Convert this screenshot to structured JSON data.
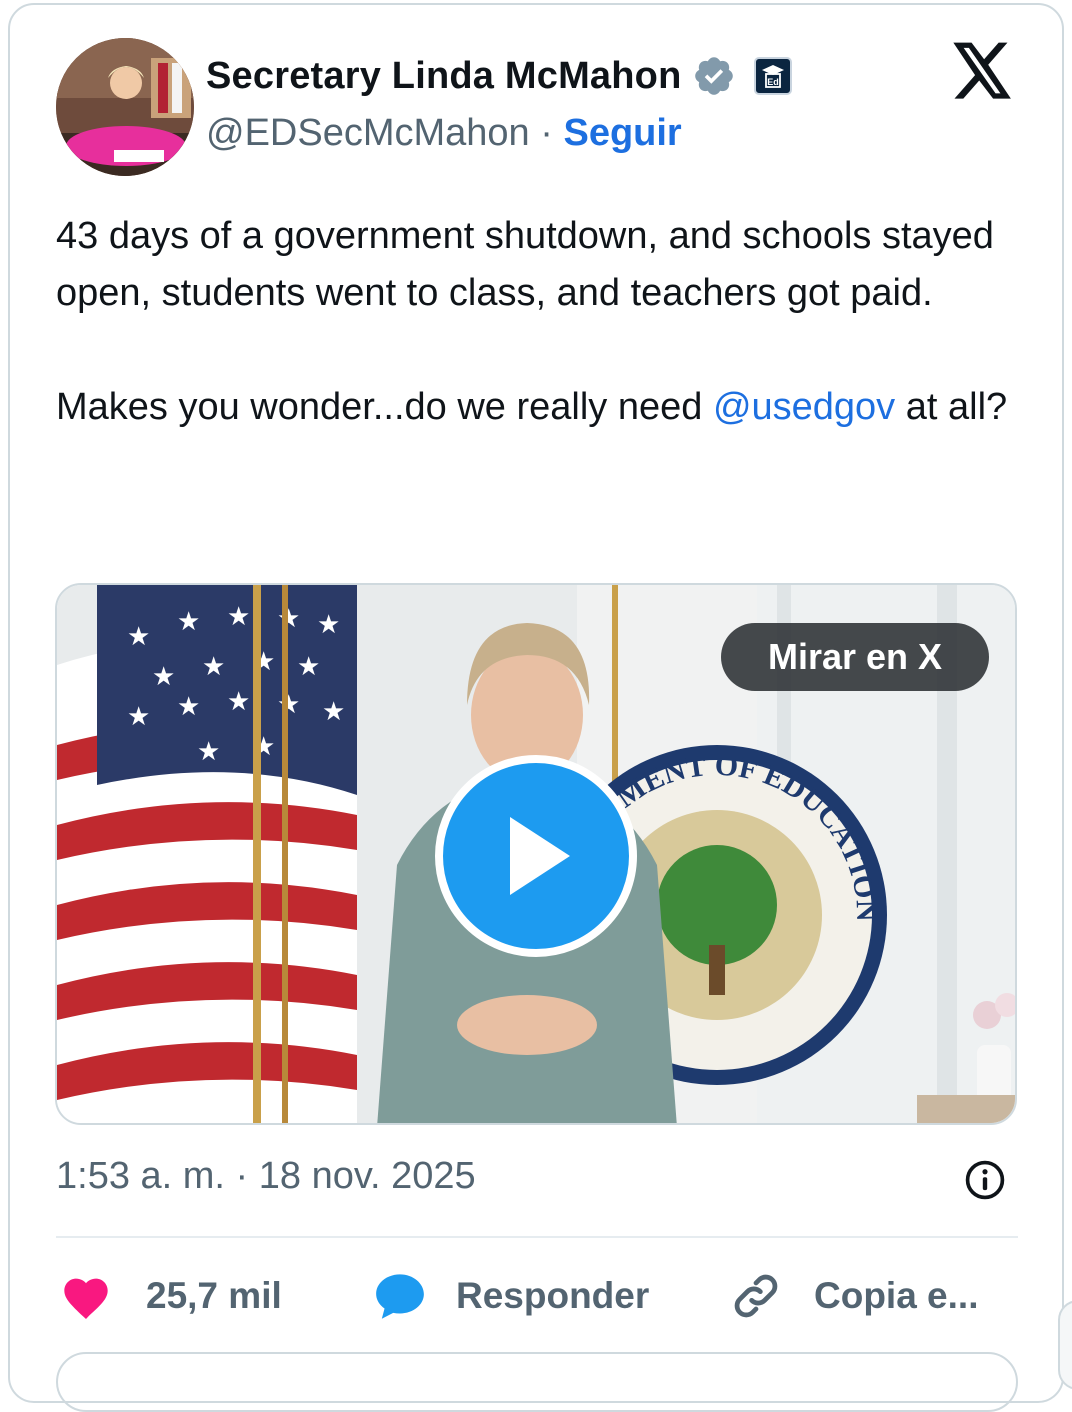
{
  "author": {
    "name": "Secretary Linda McMahon",
    "handle": "@EDSecMcMahon",
    "separator": " · ",
    "follow_label": "Seguir",
    "verified_icon": "verified-badge-icon",
    "affiliate_badge": "Ed",
    "avatar_icon": "avatar-photo"
  },
  "tweet": {
    "line1": "43 days of a government shutdown, and schools stayed open, students went to class, and teachers got paid.",
    "line2_prefix": "Makes you wonder...do we really need ",
    "mention": "@usedgov",
    "line2_suffix": " at all?"
  },
  "media": {
    "watch_label": "Mirar en X",
    "play_icon": "play-icon",
    "seal_text": "DEPARTMENT OF EDUCATION"
  },
  "timestamp": "1:53 a. m. · 18 nov. 2025",
  "actions": {
    "like_count": "25,7 mil",
    "reply_label": "Responder",
    "copy_label": "Copia e..."
  },
  "colors": {
    "accent": "#1d9bf0",
    "link": "#1d6fe0",
    "like": "#f91880",
    "muted": "#536471"
  }
}
